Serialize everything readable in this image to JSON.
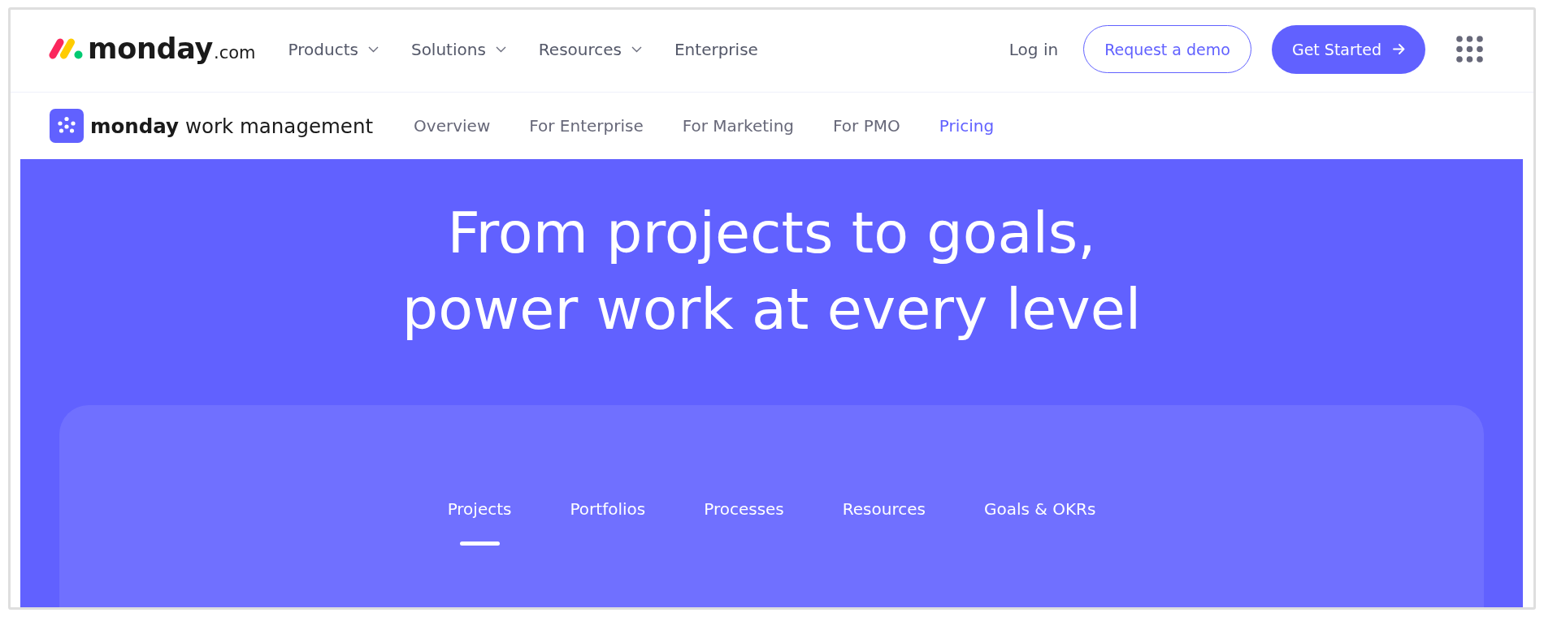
{
  "header": {
    "logo": {
      "name": "monday",
      "suffix": ".com"
    },
    "nav": [
      {
        "label": "Products",
        "has_dropdown": true
      },
      {
        "label": "Solutions",
        "has_dropdown": true
      },
      {
        "label": "Resources",
        "has_dropdown": true
      },
      {
        "label": "Enterprise",
        "has_dropdown": false
      }
    ],
    "login": "Log in",
    "demo_button": "Request a demo",
    "cta_button": "Get Started"
  },
  "product_bar": {
    "title": "**monday** work management",
    "links": [
      {
        "label": "Overview",
        "highlighted": false
      },
      {
        "label": "For Enterprise",
        "highlighted": false
      },
      {
        "label": "For Marketing",
        "highlighted": false
      },
      {
        "label": "For PMO",
        "highlighted": false
      },
      {
        "label": "Pricing",
        "highlighted": true
      }
    ]
  },
  "hero": {
    "title": "From projects to goals, power work at every level",
    "tabs": [
      {
        "label": "Projects",
        "selected": true
      },
      {
        "label": "Portfolios",
        "selected": false
      },
      {
        "label": "Processes",
        "selected": false
      },
      {
        "label": "Resources",
        "selected": false
      },
      {
        "label": "Goals & OKRs",
        "selected": false
      }
    ]
  }
}
